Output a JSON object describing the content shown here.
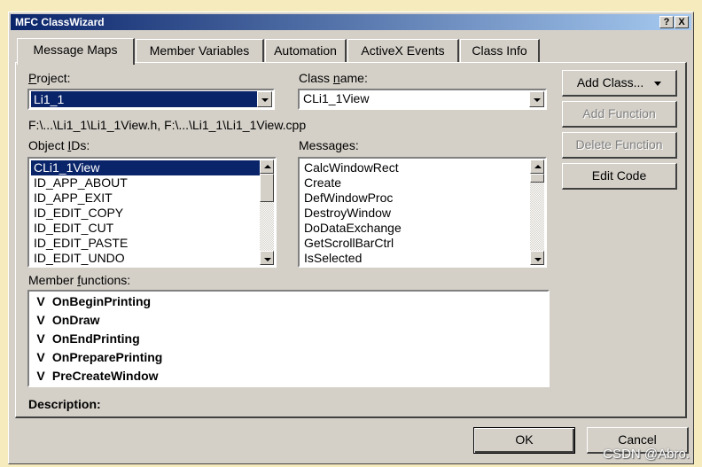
{
  "window": {
    "title": "MFC ClassWizard",
    "help_btn": "?",
    "close_btn": "X"
  },
  "tabs": [
    {
      "label": "Message Maps",
      "active": true
    },
    {
      "label": "Member Variables",
      "active": false
    },
    {
      "label": "Automation",
      "active": false
    },
    {
      "label": "ActiveX Events",
      "active": false
    },
    {
      "label": "Class Info",
      "active": false
    }
  ],
  "project": {
    "label": "Project:",
    "value": "Li1_1"
  },
  "class_name": {
    "label": "Class name:",
    "value": "CLi1_1View"
  },
  "file_path": "F:\\...\\Li1_1\\Li1_1View.h, F:\\...\\Li1_1\\Li1_1View.cpp",
  "object_ids": {
    "label": "Object IDs:",
    "items": [
      "CLi1_1View",
      "ID_APP_ABOUT",
      "ID_APP_EXIT",
      "ID_EDIT_COPY",
      "ID_EDIT_CUT",
      "ID_EDIT_PASTE",
      "ID_EDIT_UNDO"
    ],
    "selected": 0
  },
  "messages": {
    "label": "Messages:",
    "items": [
      "CalcWindowRect",
      "Create",
      "DefWindowProc",
      "DestroyWindow",
      "DoDataExchange",
      "GetScrollBarCtrl",
      "IsSelected"
    ]
  },
  "member_functions": {
    "label": "Member functions:",
    "items": [
      {
        "mark": "V",
        "name": "OnBeginPrinting"
      },
      {
        "mark": "V",
        "name": "OnDraw"
      },
      {
        "mark": "V",
        "name": "OnEndPrinting"
      },
      {
        "mark": "V",
        "name": "OnPreparePrinting"
      },
      {
        "mark": "V",
        "name": "PreCreateWindow"
      }
    ]
  },
  "description_label": "Description:",
  "buttons": {
    "add_class": "Add Class...",
    "add_function": "Add Function",
    "delete_function": "Delete Function",
    "edit_code": "Edit Code",
    "ok": "OK",
    "cancel": "Cancel"
  },
  "watermark": "CSDN @Abro."
}
